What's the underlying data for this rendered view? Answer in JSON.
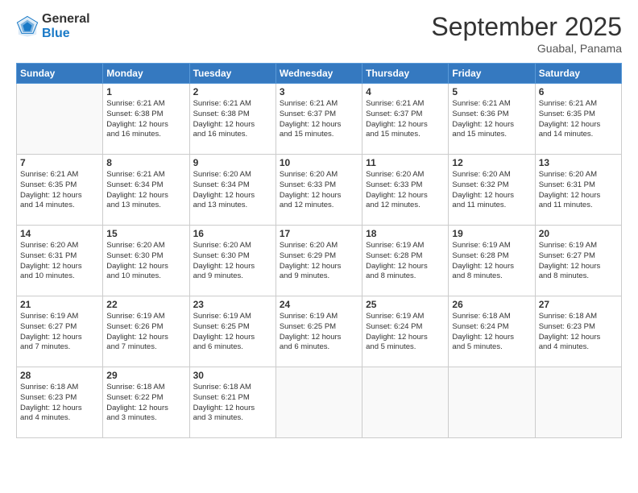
{
  "logo": {
    "general": "General",
    "blue": "Blue"
  },
  "header": {
    "month": "September 2025",
    "location": "Guabal, Panama"
  },
  "weekdays": [
    "Sunday",
    "Monday",
    "Tuesday",
    "Wednesday",
    "Thursday",
    "Friday",
    "Saturday"
  ],
  "weeks": [
    [
      {
        "day": "",
        "info": ""
      },
      {
        "day": "1",
        "info": "Sunrise: 6:21 AM\nSunset: 6:38 PM\nDaylight: 12 hours\nand 16 minutes."
      },
      {
        "day": "2",
        "info": "Sunrise: 6:21 AM\nSunset: 6:38 PM\nDaylight: 12 hours\nand 16 minutes."
      },
      {
        "day": "3",
        "info": "Sunrise: 6:21 AM\nSunset: 6:37 PM\nDaylight: 12 hours\nand 15 minutes."
      },
      {
        "day": "4",
        "info": "Sunrise: 6:21 AM\nSunset: 6:37 PM\nDaylight: 12 hours\nand 15 minutes."
      },
      {
        "day": "5",
        "info": "Sunrise: 6:21 AM\nSunset: 6:36 PM\nDaylight: 12 hours\nand 15 minutes."
      },
      {
        "day": "6",
        "info": "Sunrise: 6:21 AM\nSunset: 6:35 PM\nDaylight: 12 hours\nand 14 minutes."
      }
    ],
    [
      {
        "day": "7",
        "info": "Sunrise: 6:21 AM\nSunset: 6:35 PM\nDaylight: 12 hours\nand 14 minutes."
      },
      {
        "day": "8",
        "info": "Sunrise: 6:21 AM\nSunset: 6:34 PM\nDaylight: 12 hours\nand 13 minutes."
      },
      {
        "day": "9",
        "info": "Sunrise: 6:20 AM\nSunset: 6:34 PM\nDaylight: 12 hours\nand 13 minutes."
      },
      {
        "day": "10",
        "info": "Sunrise: 6:20 AM\nSunset: 6:33 PM\nDaylight: 12 hours\nand 12 minutes."
      },
      {
        "day": "11",
        "info": "Sunrise: 6:20 AM\nSunset: 6:33 PM\nDaylight: 12 hours\nand 12 minutes."
      },
      {
        "day": "12",
        "info": "Sunrise: 6:20 AM\nSunset: 6:32 PM\nDaylight: 12 hours\nand 11 minutes."
      },
      {
        "day": "13",
        "info": "Sunrise: 6:20 AM\nSunset: 6:31 PM\nDaylight: 12 hours\nand 11 minutes."
      }
    ],
    [
      {
        "day": "14",
        "info": "Sunrise: 6:20 AM\nSunset: 6:31 PM\nDaylight: 12 hours\nand 10 minutes."
      },
      {
        "day": "15",
        "info": "Sunrise: 6:20 AM\nSunset: 6:30 PM\nDaylight: 12 hours\nand 10 minutes."
      },
      {
        "day": "16",
        "info": "Sunrise: 6:20 AM\nSunset: 6:30 PM\nDaylight: 12 hours\nand 9 minutes."
      },
      {
        "day": "17",
        "info": "Sunrise: 6:20 AM\nSunset: 6:29 PM\nDaylight: 12 hours\nand 9 minutes."
      },
      {
        "day": "18",
        "info": "Sunrise: 6:19 AM\nSunset: 6:28 PM\nDaylight: 12 hours\nand 8 minutes."
      },
      {
        "day": "19",
        "info": "Sunrise: 6:19 AM\nSunset: 6:28 PM\nDaylight: 12 hours\nand 8 minutes."
      },
      {
        "day": "20",
        "info": "Sunrise: 6:19 AM\nSunset: 6:27 PM\nDaylight: 12 hours\nand 8 minutes."
      }
    ],
    [
      {
        "day": "21",
        "info": "Sunrise: 6:19 AM\nSunset: 6:27 PM\nDaylight: 12 hours\nand 7 minutes."
      },
      {
        "day": "22",
        "info": "Sunrise: 6:19 AM\nSunset: 6:26 PM\nDaylight: 12 hours\nand 7 minutes."
      },
      {
        "day": "23",
        "info": "Sunrise: 6:19 AM\nSunset: 6:25 PM\nDaylight: 12 hours\nand 6 minutes."
      },
      {
        "day": "24",
        "info": "Sunrise: 6:19 AM\nSunset: 6:25 PM\nDaylight: 12 hours\nand 6 minutes."
      },
      {
        "day": "25",
        "info": "Sunrise: 6:19 AM\nSunset: 6:24 PM\nDaylight: 12 hours\nand 5 minutes."
      },
      {
        "day": "26",
        "info": "Sunrise: 6:18 AM\nSunset: 6:24 PM\nDaylight: 12 hours\nand 5 minutes."
      },
      {
        "day": "27",
        "info": "Sunrise: 6:18 AM\nSunset: 6:23 PM\nDaylight: 12 hours\nand 4 minutes."
      }
    ],
    [
      {
        "day": "28",
        "info": "Sunrise: 6:18 AM\nSunset: 6:23 PM\nDaylight: 12 hours\nand 4 minutes."
      },
      {
        "day": "29",
        "info": "Sunrise: 6:18 AM\nSunset: 6:22 PM\nDaylight: 12 hours\nand 3 minutes."
      },
      {
        "day": "30",
        "info": "Sunrise: 6:18 AM\nSunset: 6:21 PM\nDaylight: 12 hours\nand 3 minutes."
      },
      {
        "day": "",
        "info": ""
      },
      {
        "day": "",
        "info": ""
      },
      {
        "day": "",
        "info": ""
      },
      {
        "day": "",
        "info": ""
      }
    ]
  ]
}
